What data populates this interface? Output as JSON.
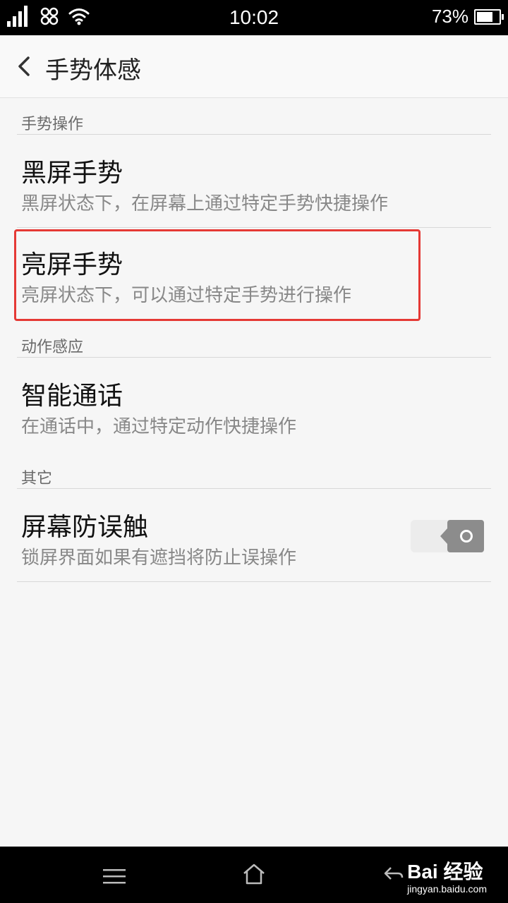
{
  "status_bar": {
    "time": "10:02",
    "battery_percent_text": "73%",
    "battery_level": 0.73
  },
  "header": {
    "title": "手势体感"
  },
  "sections": [
    {
      "header": "手势操作",
      "items": [
        {
          "title": "黑屏手势",
          "subtitle": "黑屏状态下，在屏幕上通过特定手势快捷操作"
        },
        {
          "title": "亮屏手势",
          "subtitle": "亮屏状态下，可以通过特定手势进行操作"
        }
      ]
    },
    {
      "header": "动作感应",
      "items": [
        {
          "title": "智能通话",
          "subtitle": "在通话中，通过特定动作快捷操作"
        }
      ]
    },
    {
      "header": "其它",
      "items": [
        {
          "title": "屏幕防误触",
          "subtitle": "锁屏界面如果有遮挡将防止误操作",
          "toggle": "off"
        }
      ]
    }
  ],
  "watermark": {
    "brand": "Bai 经验",
    "url": "jingyan.baidu.com"
  },
  "colors": {
    "highlight": "#e53935",
    "statusbar": "#000000",
    "background": "#f6f6f6"
  },
  "icons": [
    "signal-icon",
    "unicom-icon",
    "wifi-icon",
    "battery-icon",
    "back-arrow-icon",
    "menu-icon",
    "home-icon",
    "nav-back-icon"
  ]
}
